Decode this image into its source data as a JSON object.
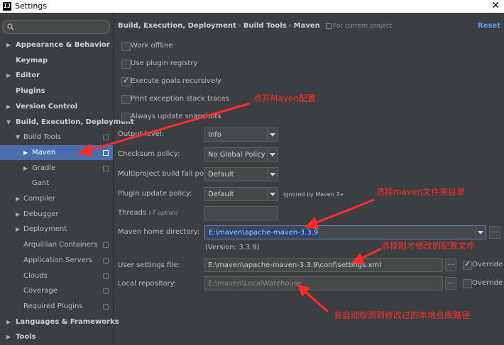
{
  "window": {
    "title": "Settings",
    "logo": "IJ",
    "close_glyph": "✕"
  },
  "search": {
    "placeholder": "",
    "icon": "search-icon"
  },
  "sidebar": {
    "items": [
      {
        "label": "Appearance & Behavior",
        "level": 0,
        "bold": true,
        "arrow": "▶"
      },
      {
        "label": "Keymap",
        "level": 0,
        "bold": true,
        "arrow": ""
      },
      {
        "label": "Editor",
        "level": 0,
        "bold": true,
        "arrow": "▶"
      },
      {
        "label": "Plugins",
        "level": 0,
        "bold": true,
        "arrow": ""
      },
      {
        "label": "Version Control",
        "level": 0,
        "bold": true,
        "arrow": "▶"
      },
      {
        "label": "Build, Execution, Deployment",
        "level": 0,
        "bold": true,
        "arrow": "▼"
      },
      {
        "label": "Build Tools",
        "level": 1,
        "bold": false,
        "arrow": "▼"
      },
      {
        "label": "Maven",
        "level": 2,
        "bold": false,
        "arrow": "▶",
        "selected": true
      },
      {
        "label": "Gradle",
        "level": 2,
        "bold": false,
        "arrow": "▶"
      },
      {
        "label": "Gant",
        "level": 2,
        "bold": false,
        "arrow": ""
      },
      {
        "label": "Compiler",
        "level": 1,
        "bold": false,
        "arrow": "▶"
      },
      {
        "label": "Debugger",
        "level": 1,
        "bold": false,
        "arrow": "▶"
      },
      {
        "label": "Deployment",
        "level": 1,
        "bold": false,
        "arrow": "▶"
      },
      {
        "label": "Arquillian Containers",
        "level": 1,
        "bold": false,
        "arrow": ""
      },
      {
        "label": "Application Servers",
        "level": 1,
        "bold": false,
        "arrow": ""
      },
      {
        "label": "Clouds",
        "level": 1,
        "bold": false,
        "arrow": ""
      },
      {
        "label": "Coverage",
        "level": 1,
        "bold": false,
        "arrow": ""
      },
      {
        "label": "Required Plugins",
        "level": 1,
        "bold": false,
        "arrow": ""
      },
      {
        "label": "Languages & Frameworks",
        "level": 0,
        "bold": true,
        "arrow": "▶"
      },
      {
        "label": "Tools",
        "level": 0,
        "bold": true,
        "arrow": "▶"
      }
    ]
  },
  "breadcrumb": {
    "parts": [
      "Build, Execution, Deployment",
      "Build Tools",
      "Maven"
    ],
    "separator": "›",
    "scope_note": "For current project"
  },
  "reset_label": "Reset",
  "checkboxes": [
    {
      "label": "Work offline",
      "checked": false
    },
    {
      "label": "Use plugin registry",
      "checked": false
    },
    {
      "label": "Execute goals recursively",
      "checked": true
    },
    {
      "label": "Print exception stack traces",
      "checked": false
    },
    {
      "label": "Always update snapshots",
      "checked": false
    }
  ],
  "fields": {
    "output_level": {
      "label": "Output level:",
      "value": "Info"
    },
    "checksum_policy": {
      "label": "Checksum policy:",
      "value": "No Global Policy"
    },
    "multiproject_policy": {
      "label": "Multiproject build fail policy:",
      "value": "Default"
    },
    "plugin_update_policy": {
      "label": "Plugin update policy:",
      "value": "Default",
      "note": "ignored by Maven 3+"
    },
    "threads": {
      "label": "Threads",
      "hint": "(-T option)",
      "value": ""
    },
    "maven_home": {
      "label": "Maven home directory:",
      "value": "E:\\maven\\apache-maven-3.3.9",
      "version": "(Version: 3.3.9)"
    },
    "user_settings": {
      "label": "User settings file:",
      "value": "E:\\maven\\apache-maven-3.3.9\\conf\\settings.xml",
      "override_label": "Override",
      "override_checked": true
    },
    "local_repo": {
      "label": "Local repository:",
      "value": "E:\\maven\\LocalWarehouse",
      "override_label": "Override",
      "override_checked": false
    }
  },
  "browse_glyph": "...",
  "annotations": {
    "open_maven": "点开Maven配置",
    "select_maven_dir": "选择maven文件夹目录",
    "select_config": "选择刚才修改的配置文件",
    "auto_detect": "会自动检测到修改过的本地仓库路径",
    "color": "#ff2b2b"
  },
  "colors": {
    "selection": "#4b6eaf",
    "link": "#589df6",
    "background": "#3c3f41"
  }
}
